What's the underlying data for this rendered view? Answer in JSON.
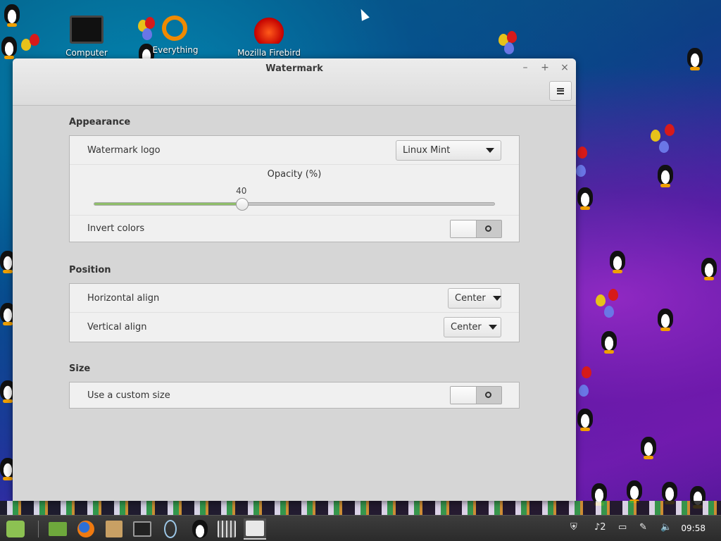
{
  "desktop": {
    "icons": [
      {
        "label": "Computer",
        "icon": "monitor-icon"
      },
      {
        "label": "Everything",
        "icon": "magnifier-icon"
      },
      {
        "label": "Mozilla Firebird",
        "icon": "firebird-icon"
      }
    ]
  },
  "window": {
    "title": "Watermark",
    "controls": {
      "minimize": "–",
      "maximize": "+",
      "close": "×"
    }
  },
  "appearance": {
    "title": "Appearance",
    "logo_label": "Watermark logo",
    "logo_value": "Linux Mint",
    "opacity_label": "Opacity (%)",
    "opacity_value": "40",
    "opacity_fraction": 0.368,
    "invert_label": "Invert colors",
    "invert_on": false
  },
  "position": {
    "title": "Position",
    "horizontal_label": "Horizontal align",
    "horizontal_value": "Center",
    "vertical_label": "Vertical align",
    "vertical_value": "Center"
  },
  "size": {
    "title": "Size",
    "custom_label": "Use a custom size",
    "custom_on": false
  },
  "taskbar": {
    "apps": [
      "menu-mint-icon",
      "files-icon",
      "firefox-icon",
      "package-icon",
      "terminal-icon",
      "ring-icon",
      "penguin-icon",
      "mixer-icon",
      "window-icon"
    ],
    "tray": {
      "notifications": "2"
    },
    "clock": "09:58"
  },
  "colors": {
    "accent": "#8fbe6a",
    "window_bg": "#d6d6d6"
  }
}
